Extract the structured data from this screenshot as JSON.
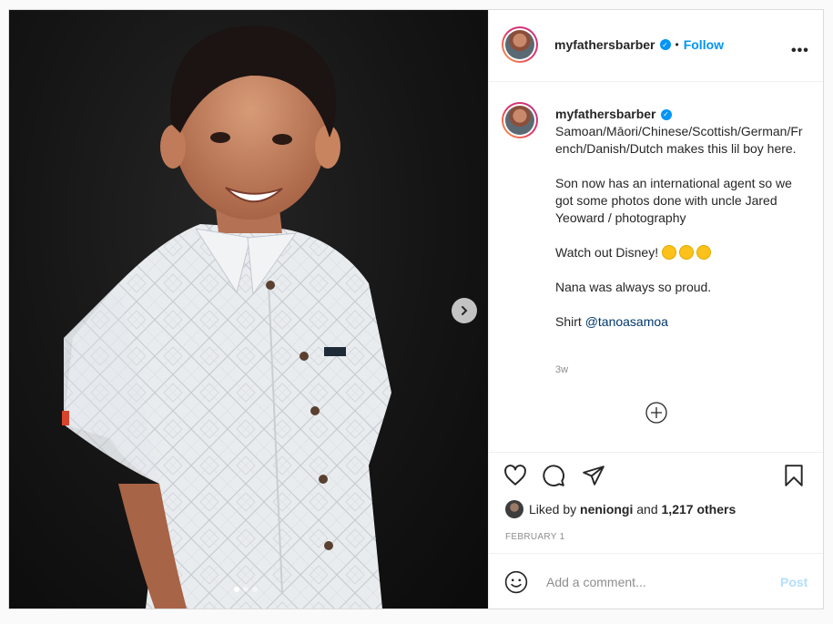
{
  "media": {
    "alt": "Photo of smiling boy in white patterned shirt",
    "slides_count": 3,
    "active_slide": 1,
    "shirt_tag": "TANOA"
  },
  "header": {
    "username": "myfathersbarber",
    "separator": "•",
    "follow_label": "Follow",
    "more_label": "•••"
  },
  "caption": {
    "username": "myfathersbarber",
    "line1": "Samoan/Māori/Chinese/Scottish/German/French/Danish/Dutch makes this lil boy here.",
    "line2": "Son now has an international agent so we got some photos done with uncle Jared Yeoward / photography",
    "line3": "Watch out Disney!",
    "line4": "Nana was always so proud.",
    "line5_prefix": "Shirt ",
    "line5_mention": "@tanoasamoa",
    "time": "3w"
  },
  "likes": {
    "prefix": "Liked by ",
    "user": "neniongi",
    "middle": " and ",
    "count": "1,217 others"
  },
  "date": "FEBRUARY 1",
  "comment": {
    "placeholder": "Add a comment...",
    "post_label": "Post"
  },
  "colors": {
    "accent": "#0095f6",
    "post_disabled": "#b2dffc",
    "mention": "#00376b",
    "muted": "#8e8e8e"
  },
  "icons": [
    "chevron-right-icon",
    "heart-icon",
    "comment-icon",
    "share-icon",
    "bookmark-icon",
    "add-circle-icon",
    "emoji-icon",
    "verified-icon",
    "more-icon"
  ]
}
